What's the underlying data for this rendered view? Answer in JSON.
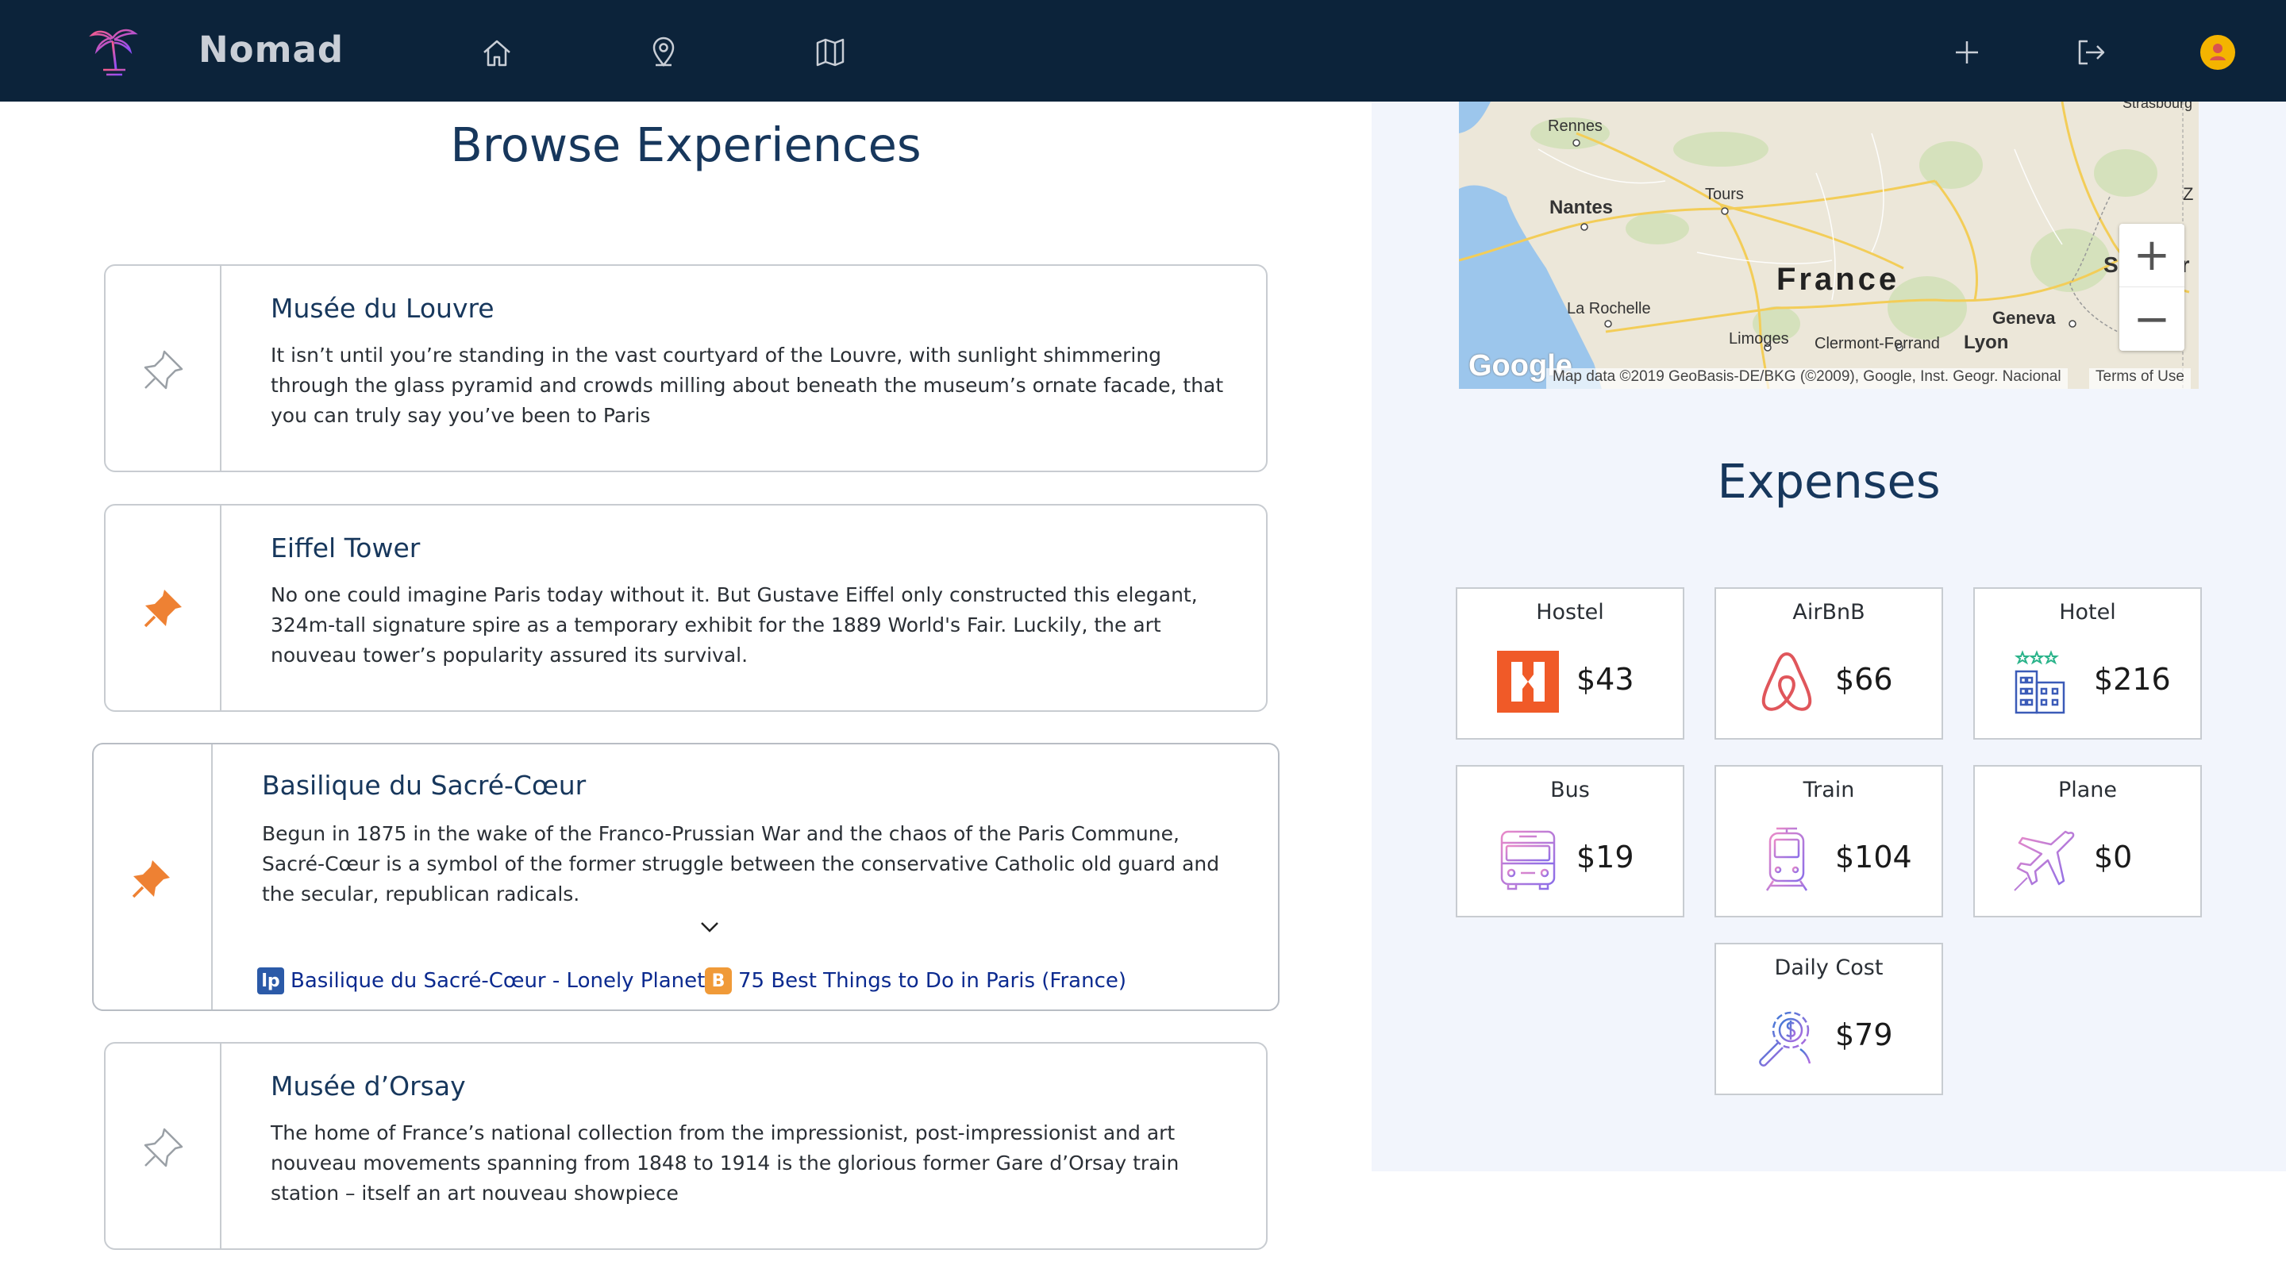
{
  "navbar": {
    "brand": "Nomad",
    "nav_icons": [
      "home-icon",
      "location-pin-icon",
      "map-icon"
    ],
    "action_icons": [
      "plus-icon",
      "logout-icon",
      "user-avatar-icon"
    ],
    "background": "#0c233a"
  },
  "browse": {
    "title": "Browse Experiences",
    "cards": [
      {
        "title": "Musée du Louvre",
        "description": "It isn’t until you’re standing in the vast courtyard of the Louvre, with sunlight shimmering through the glass pyramid and crowds milling about beneath the museum’s ornate facade, that you can truly say you’ve been to Paris",
        "pinned": false
      },
      {
        "title": "Eiffel Tower",
        "description": "No one could imagine Paris today without it. But Gustave Eiffel only constructed this elegant, 324m-tall signature spire as a temporary exhibit for the 1889 World's Fair. Luckily, the art nouveau tower’s popularity assured its survival.",
        "pinned": true
      },
      {
        "title": "Basilique du Sacré-Cœur",
        "description": "Begun in 1875 in the wake of the Franco-Prussian War and the chaos of the Paris Commune, Sacré-Cœur is a symbol of the former struggle between the conservative Catholic old guard and the secular, republican radicals.",
        "pinned": true,
        "links": [
          {
            "label": "Basilique du Sacré-Cœur - Lonely Planet",
            "icon": "lp"
          },
          {
            "label": "75 Best Things to Do in Paris (France)",
            "icon": "blogger"
          }
        ]
      },
      {
        "title": "Musée d’Orsay",
        "description": "The home of France’s national collection from the impressionist, post-impressionist and art nouveau movements spanning from 1848 to 1914 is the glorious former Gare d’Orsay train station – itself an art nouveau showpiece",
        "pinned": false
      }
    ],
    "pin_active_color": "#ee8133",
    "pin_inactive_color": "#9aa0a6"
  },
  "map": {
    "labels": [
      "Rennes",
      "Nantes",
      "Tours",
      "France",
      "La Rochelle",
      "Limoges",
      "Clermont-Ferrand",
      "Lyon",
      "Geneva",
      "Strasbourg",
      "Z",
      "S",
      "er"
    ],
    "attribution": "Map data ©2019 GeoBasis-DE/BKG (©2009), Google, Inst. Geogr. Nacional",
    "terms": "Terms of Use",
    "logo": "Google",
    "zoom_in": "+",
    "zoom_out": "−"
  },
  "expenses": {
    "title": "Expenses",
    "items": [
      {
        "label": "Hostel",
        "value": "$43",
        "icon": "hostel-icon"
      },
      {
        "label": "AirBnB",
        "value": "$66",
        "icon": "airbnb-icon"
      },
      {
        "label": "Hotel",
        "value": "$216",
        "icon": "hotel-icon"
      },
      {
        "label": "Bus",
        "value": "$19",
        "icon": "bus-icon"
      },
      {
        "label": "Train",
        "value": "$104",
        "icon": "train-icon"
      },
      {
        "label": "Plane",
        "value": "$0",
        "icon": "plane-icon"
      },
      {
        "label": "Daily Cost",
        "value": "$79",
        "icon": "daily-cost-icon"
      }
    ]
  }
}
